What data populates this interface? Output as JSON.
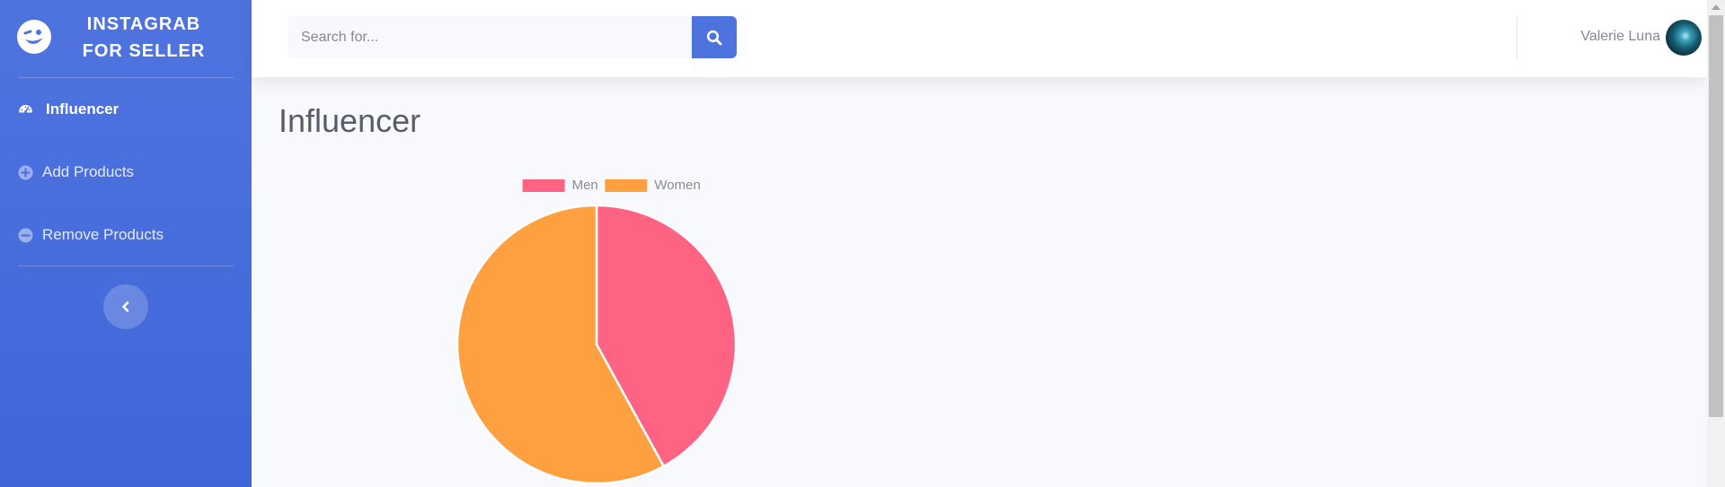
{
  "brand": {
    "line1": "INSTAGRAB",
    "line2": "FOR SELLER",
    "icon": "wink-face-icon"
  },
  "sidebar": {
    "items": [
      {
        "label": "Influencer",
        "icon": "dashboard-gauge-icon",
        "active": true
      },
      {
        "label": "Add Products",
        "icon": "plus-circle-icon",
        "active": false
      },
      {
        "label": "Remove Products",
        "icon": "minus-circle-icon",
        "active": false
      }
    ],
    "toggle_icon": "chevron-left-icon"
  },
  "topbar": {
    "search": {
      "placeholder": "Search for...",
      "value": "",
      "button_icon": "search-icon"
    },
    "user": {
      "name": "Valerie Luna"
    }
  },
  "main": {
    "title": "Influencer"
  },
  "colors": {
    "primary": "#4e73df",
    "men": "#ff6384",
    "women": "#ffa040",
    "text_dark": "#5a5c69",
    "text_muted": "#858796"
  },
  "chart_data": {
    "type": "pie",
    "categories": [
      "Men",
      "Women"
    ],
    "values": [
      42,
      58
    ],
    "colors": [
      "#ff6384",
      "#ffa040"
    ],
    "legend": "top"
  }
}
